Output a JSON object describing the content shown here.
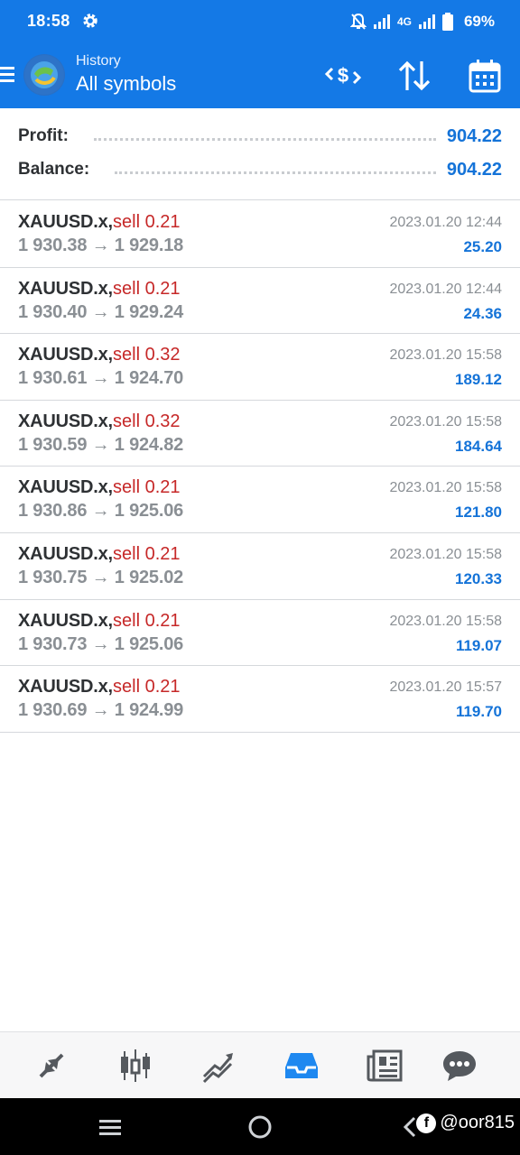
{
  "status_bar": {
    "time": "18:58",
    "network": "4G",
    "battery": "69%"
  },
  "app_bar": {
    "subtitle": "History",
    "title": "All symbols"
  },
  "summary": {
    "profit_label": "Profit:",
    "profit_value": "904.22",
    "balance_label": "Balance:",
    "balance_value": "904.22"
  },
  "deals": [
    {
      "symbol": "XAUUSD.x,",
      "type": "sell 0.21",
      "open": "1 930.38",
      "close": "1 929.18",
      "time": "2023.01.20 12:44",
      "profit": "25.20"
    },
    {
      "symbol": "XAUUSD.x,",
      "type": "sell 0.21",
      "open": "1 930.40",
      "close": "1 929.24",
      "time": "2023.01.20 12:44",
      "profit": "24.36"
    },
    {
      "symbol": "XAUUSD.x,",
      "type": "sell 0.32",
      "open": "1 930.61",
      "close": "1 924.70",
      "time": "2023.01.20 15:58",
      "profit": "189.12"
    },
    {
      "symbol": "XAUUSD.x,",
      "type": "sell 0.32",
      "open": "1 930.59",
      "close": "1 924.82",
      "time": "2023.01.20 15:58",
      "profit": "184.64"
    },
    {
      "symbol": "XAUUSD.x,",
      "type": "sell 0.21",
      "open": "1 930.86",
      "close": "1 925.06",
      "time": "2023.01.20 15:58",
      "profit": "121.80"
    },
    {
      "symbol": "XAUUSD.x,",
      "type": "sell 0.21",
      "open": "1 930.75",
      "close": "1 925.02",
      "time": "2023.01.20 15:58",
      "profit": "120.33"
    },
    {
      "symbol": "XAUUSD.x,",
      "type": "sell 0.21",
      "open": "1 930.73",
      "close": "1 925.06",
      "time": "2023.01.20 15:58",
      "profit": "119.07"
    },
    {
      "symbol": "XAUUSD.x,",
      "type": "sell 0.21",
      "open": "1 930.69",
      "close": "1 924.99",
      "time": "2023.01.20 15:57",
      "profit": "119.70"
    }
  ],
  "arrow": "→",
  "bottom_nav": [
    "quotes-icon",
    "chart-icon",
    "trade-icon",
    "history-icon",
    "news-icon",
    "chat-icon"
  ],
  "bottom_nav_active": "history-icon",
  "watermark": "@oor815",
  "colors": {
    "header": "#1479e6",
    "sell": "#c62828",
    "profit": "#1473d8",
    "active_nav": "#1e88f0"
  }
}
